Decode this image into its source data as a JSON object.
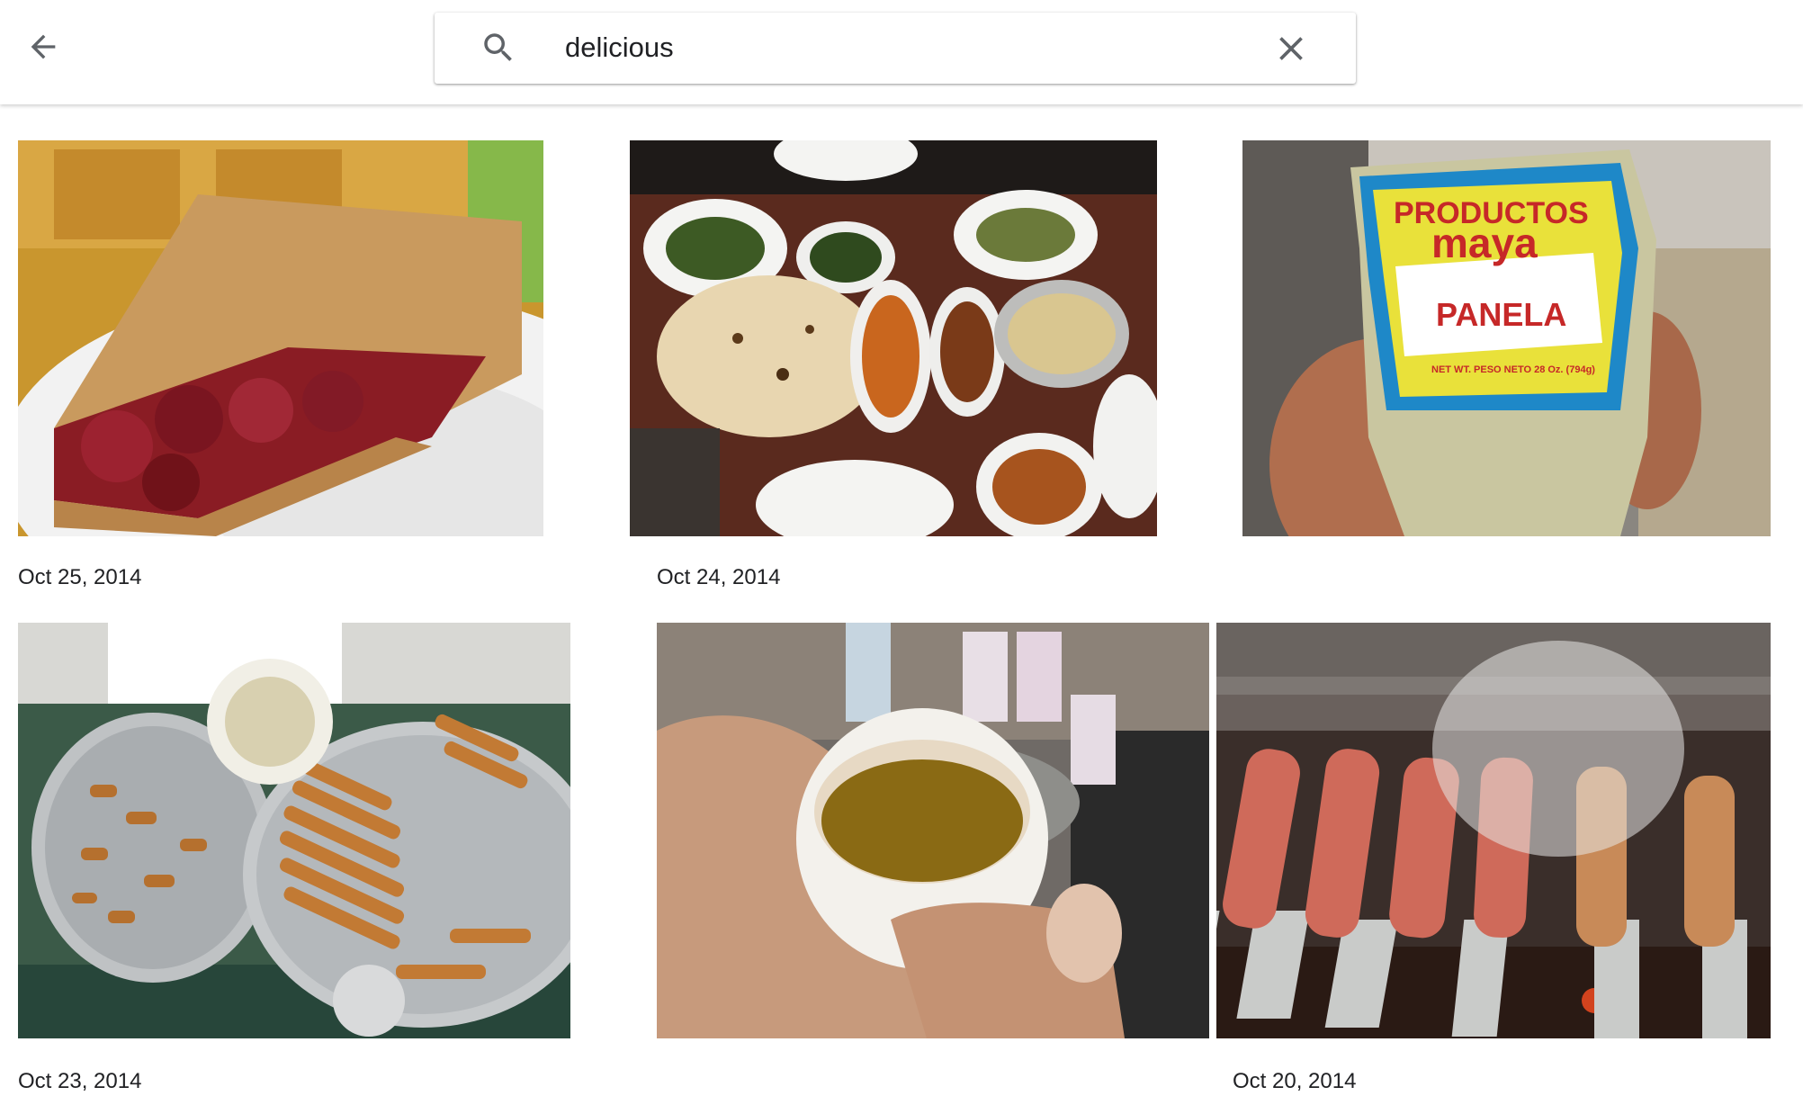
{
  "search": {
    "query": "delicious"
  },
  "icons": {
    "back": "arrow-back-icon",
    "search": "search-icon",
    "clear": "close-icon"
  },
  "groups": [
    {
      "date": "Oct 25, 2014"
    },
    {
      "date": "Oct 24, 2014"
    },
    {
      "date": "Oct 23, 2014"
    },
    {
      "date": "Oct 20, 2014"
    }
  ],
  "photos": [
    {
      "subject": "cherry pie slice"
    },
    {
      "subject": "indian food table"
    },
    {
      "subject": "panela package",
      "package_text": [
        "PRODUCTOS",
        "maya",
        "PANELA",
        "NET WT. PESO NETO 28 Oz. (794g)"
      ]
    },
    {
      "subject": "pastries on trays"
    },
    {
      "subject": "cup of tea"
    },
    {
      "subject": "kebabs on grill"
    }
  ],
  "colors": {
    "text": "#202124",
    "icon": "#5f6368"
  }
}
